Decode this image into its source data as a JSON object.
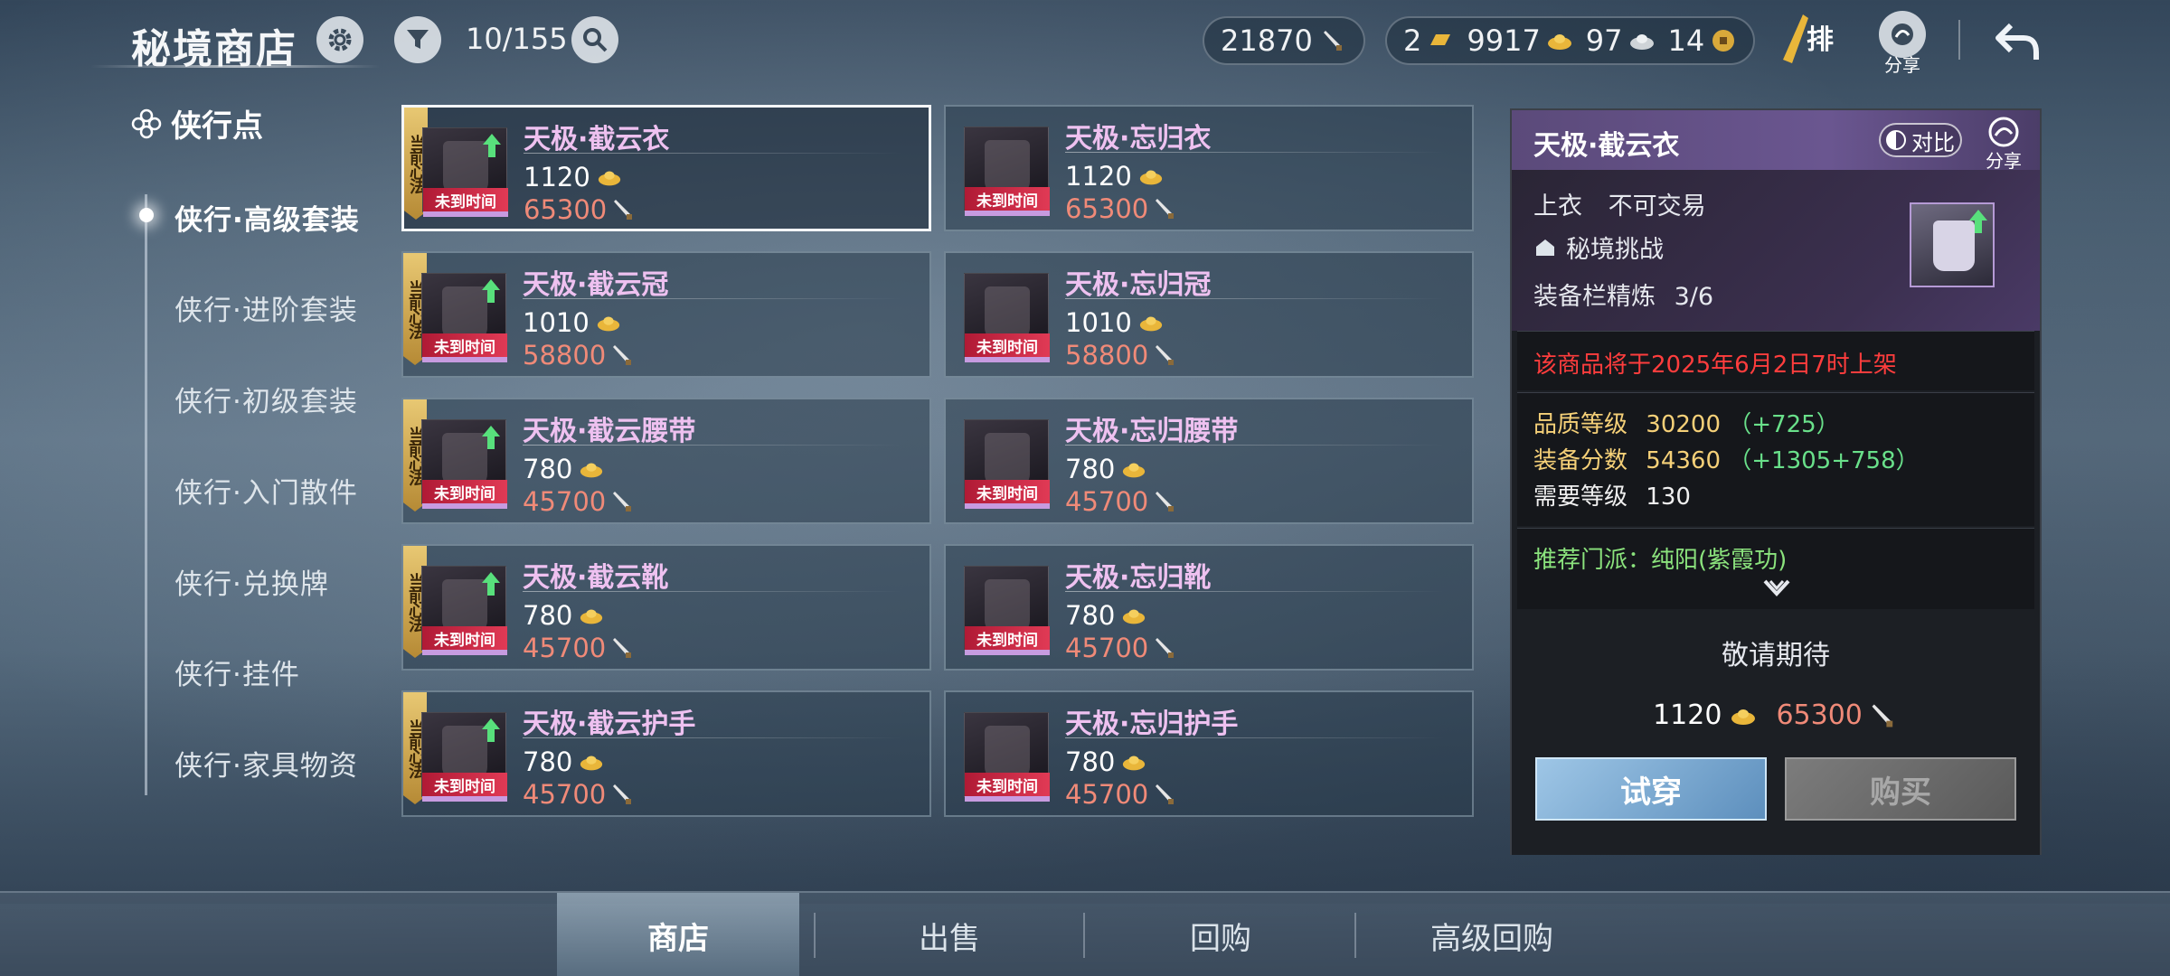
{
  "header": {
    "title": "秘境商店",
    "filter_count": "10/155",
    "currency_main": "21870",
    "currency_gold_bar": "2",
    "currency_gold": "9917",
    "currency_silver": "97",
    "currency_coin": "14",
    "rank_label": "排",
    "share_label": "分享"
  },
  "sidebar": {
    "heading": "侠行点",
    "items": [
      {
        "label": "侠行·高级套装"
      },
      {
        "label": "侠行·进阶套装"
      },
      {
        "label": "侠行·初级套装"
      },
      {
        "label": "侠行·入门散件"
      },
      {
        "label": "侠行·兑换牌"
      },
      {
        "label": "侠行·挂件"
      },
      {
        "label": "侠行·家具物资"
      }
    ]
  },
  "items": [
    {
      "name": "天极·截云衣",
      "gold": "1120",
      "silver": "65300",
      "badge": "当前心法",
      "status": "未到时间"
    },
    {
      "name": "天极·忘归衣",
      "gold": "1120",
      "silver": "65300",
      "badge": "",
      "status": "未到时间"
    },
    {
      "name": "天极·截云冠",
      "gold": "1010",
      "silver": "58800",
      "badge": "当前心法",
      "status": "未到时间"
    },
    {
      "name": "天极·忘归冠",
      "gold": "1010",
      "silver": "58800",
      "badge": "",
      "status": "未到时间"
    },
    {
      "name": "天极·截云腰带",
      "gold": "780",
      "silver": "45700",
      "badge": "当前心法",
      "status": "未到时间"
    },
    {
      "name": "天极·忘归腰带",
      "gold": "780",
      "silver": "45700",
      "badge": "",
      "status": "未到时间"
    },
    {
      "name": "天极·截云靴",
      "gold": "780",
      "silver": "45700",
      "badge": "当前心法",
      "status": "未到时间"
    },
    {
      "name": "天极·忘归靴",
      "gold": "780",
      "silver": "45700",
      "badge": "",
      "status": "未到时间"
    },
    {
      "name": "天极·截云护手",
      "gold": "780",
      "silver": "45700",
      "badge": "当前心法",
      "status": "未到时间"
    },
    {
      "name": "天极·忘归护手",
      "gold": "780",
      "silver": "45700",
      "badge": "",
      "status": "未到时间"
    }
  ],
  "detail": {
    "title": "天极·截云衣",
    "compare_label": "对比",
    "share_label": "分享",
    "slot": "上衣",
    "trade": "不可交易",
    "source": "秘境挑战",
    "refine_label": "装备栏精炼",
    "refine_value": "3/6",
    "notice": "该商品将于2025年6月2日7时上架",
    "quality_label": "品质等级",
    "quality_value": "30200",
    "quality_plus": "（+725）",
    "score_label": "装备分数",
    "score_value": "54360",
    "score_plus": "（+1305+758）",
    "level_label": "需要等级",
    "level_value": "130",
    "recommend": "推荐门派：纯阳(紫霞功)",
    "coming_soon": "敬请期待",
    "price_gold": "1120",
    "price_silver": "65300",
    "try_label": "试穿",
    "buy_label": "购买"
  },
  "tabs": [
    {
      "label": "商店"
    },
    {
      "label": "出售"
    },
    {
      "label": "回购"
    },
    {
      "label": "高级回购"
    }
  ],
  "colors": {
    "gold_badge": "#d9b45a",
    "name_pink": "#eec1f0",
    "silver_price": "#f08a78",
    "status_red": "#e03a55",
    "warn_red": "#ff3d3d",
    "stat_gold": "#f5d078",
    "stat_green": "#69e08a"
  }
}
